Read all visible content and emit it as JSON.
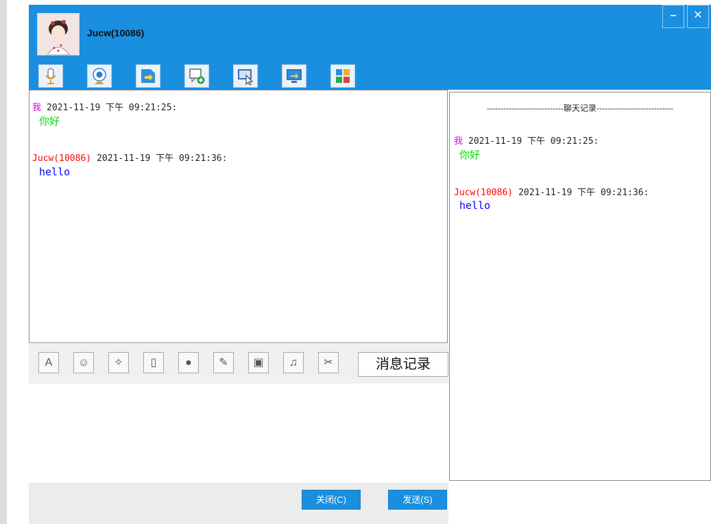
{
  "window": {
    "user_name": "Jucw(10086)",
    "minimize_glyph": "–",
    "close_glyph": "✕"
  },
  "top_toolbar": {
    "icons": [
      "microphone-icon",
      "webcam-icon",
      "send-file-icon",
      "new-message-icon",
      "remote-desktop-icon",
      "screen-share-icon",
      "apps-icon"
    ]
  },
  "chat": {
    "messages": [
      {
        "sender": "我",
        "time": "2021-11-19 下午 09:21:25:",
        "text": "你好",
        "sender_color": "#e000e0",
        "text_color": "#00dd00"
      },
      {
        "sender": "Jucw(10086)",
        "time": "2021-11-19 下午 09:21:36:",
        "text": "hello",
        "sender_color": "#ff0000",
        "text_color": "#0000ff"
      }
    ]
  },
  "history": {
    "title": "----------------------------聊天记录----------------------------",
    "messages": [
      {
        "sender": "我",
        "time": "2021-11-19 下午 09:21:25:",
        "text": "你好",
        "sender_color": "#e000e0",
        "text_color": "#00dd00"
      },
      {
        "sender": "Jucw(10086)",
        "time": "2021-11-19 下午 09:21:36:",
        "text": "hello",
        "sender_color": "#ff0000",
        "text_color": "#0000ff"
      }
    ]
  },
  "format_toolbar": {
    "buttons": [
      {
        "name": "font-icon",
        "glyph": "A"
      },
      {
        "name": "emoji-icon",
        "glyph": "☺"
      },
      {
        "name": "magic-wand-icon",
        "glyph": "✧"
      },
      {
        "name": "vibrate-icon",
        "glyph": "▯"
      },
      {
        "name": "voice-icon",
        "glyph": "●"
      },
      {
        "name": "edit-icon",
        "glyph": "✎"
      },
      {
        "name": "image-icon",
        "glyph": "▣"
      },
      {
        "name": "music-icon",
        "glyph": "♫"
      },
      {
        "name": "scissors-icon",
        "glyph": "✂"
      }
    ],
    "history_label": "消息记录"
  },
  "footer": {
    "close_label": "关闭(C)",
    "send_label": "发送(S)"
  },
  "colors": {
    "accent": "#1a8fe0",
    "toolbar_bg": "#f0f0f0",
    "footer_bg": "#ececec"
  }
}
